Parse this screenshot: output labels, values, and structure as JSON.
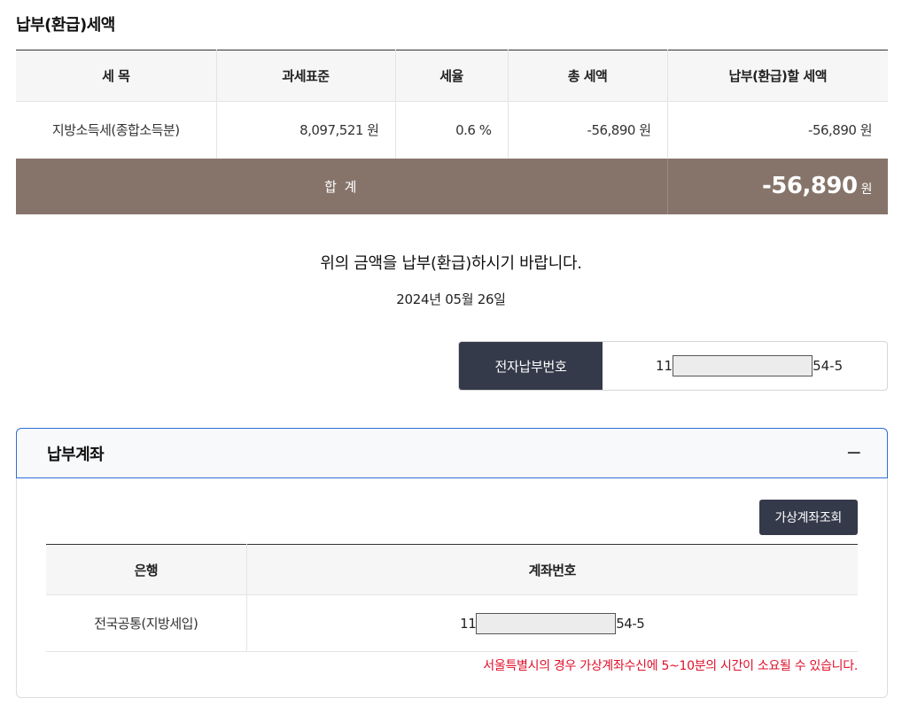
{
  "section": {
    "title": "납부(환급)세액"
  },
  "tax_table": {
    "headers": [
      "세 목",
      "과세표준",
      "세율",
      "총 세액",
      "납부(환급)할 세액"
    ],
    "rows": [
      {
        "item": "지방소득세(종합소득분)",
        "base": "8,097,521 원",
        "rate": "0.6 %",
        "total": "-56,890 원",
        "payable": "-56,890 원"
      }
    ],
    "total_row": {
      "label": "합 계",
      "amount": "-56,890",
      "unit": "원"
    }
  },
  "notice": "위의 금액을 납부(환급)하시기 바랍니다.",
  "date": "2024년 05월 26일",
  "epay": {
    "label": "전자납부번호",
    "prefix": "11",
    "suffix": "54-5"
  },
  "account_section": {
    "title": "납부계좌",
    "toggle": "−",
    "virtual_button": "가상계좌조회",
    "headers": [
      "은행",
      "계좌번호"
    ],
    "rows": [
      {
        "bank": "전국공통(지방세입)",
        "prefix": "11",
        "suffix": "54-5"
      }
    ],
    "warning": "서울특별시의 경우 가상계좌수신에 5~10분의 시간이 소요될 수 있습니다."
  }
}
